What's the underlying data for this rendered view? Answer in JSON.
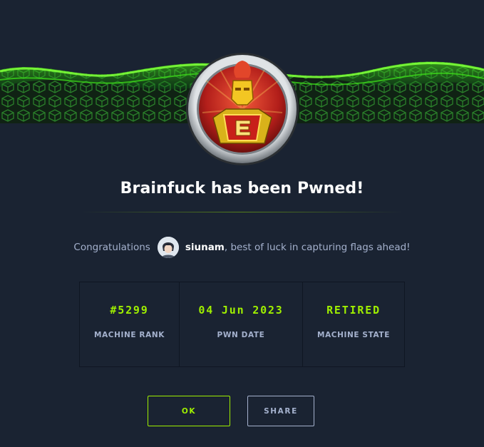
{
  "modal": {
    "title": "Brainfuck has been Pwned!",
    "congrats": {
      "prefix": "Congratulations",
      "username": "siunam",
      "suffix": ", best of luck in capturing flags ahead!"
    },
    "stats": [
      {
        "value": "#5299",
        "label": "MACHINE RANK"
      },
      {
        "value": "04 Jun 2023",
        "label": "PWN DATE"
      },
      {
        "value": "RETIRED",
        "label": "MACHINE STATE"
      }
    ],
    "buttons": {
      "ok": "OK",
      "share": "SHARE"
    }
  },
  "colors": {
    "background": "#1a2332",
    "accent": "#9fef00",
    "muted": "#a4b1cd",
    "text": "#ffffff"
  },
  "icons": {
    "badge": "machine-badge-icon",
    "avatar": "user-avatar"
  }
}
